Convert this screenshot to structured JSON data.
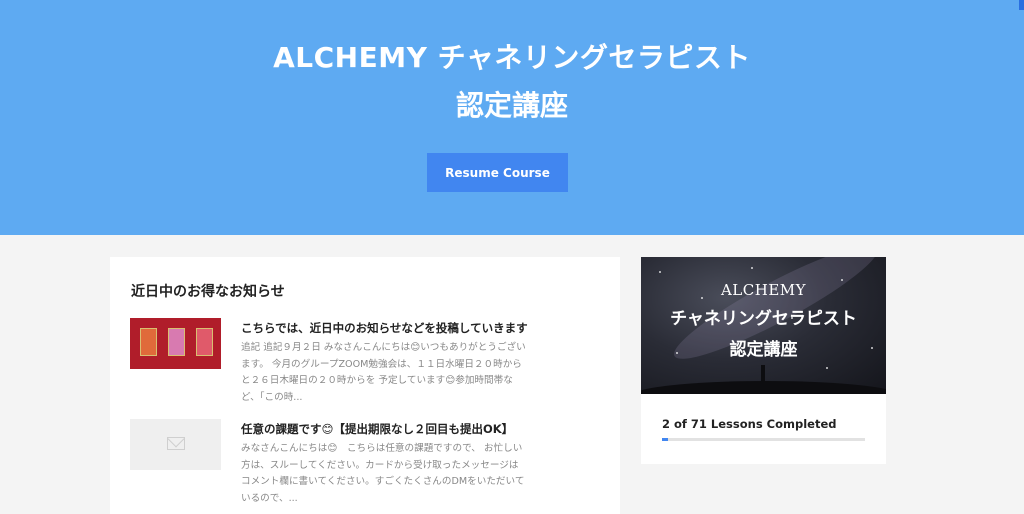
{
  "hero": {
    "title_line1": "ALCHEMY チャネリングセラピスト",
    "title_line2": "認定講座",
    "resume_label": "Resume Course",
    "background_color": "#5eaaf2",
    "button_color": "#4186f0"
  },
  "news": {
    "heading": "近日中のお得なお知らせ",
    "posts": [
      {
        "title": "こちらでは、近日中のお知らせなどを投稿していきます",
        "excerpt": "追記 追記９月２日 みなさんこんにちは😊いつもありがとうございます。 今月のグループZOOM勉強会は、１１日水曜日２０時からと２６日木曜日の２０時からを 予定しています😊参加時間帯など、「この時...",
        "thumbnail": "tarot-cards-image"
      },
      {
        "title": "任意の課題です😊【提出期限なし２回目も提出OK】",
        "excerpt": "みなさんこんにちは😊　こちらは任意の課題ですので、 お忙しい方は、スルーしてください。カードから受け取ったメッセージは コメント欄に書いてください。すごくたくさんのDMをいただいているので、...",
        "thumbnail": "mail-icon"
      }
    ]
  },
  "course": {
    "image_line1": "ALCHEMY",
    "image_line2": "チャネリングセラピスト",
    "image_line3": "認定講座",
    "progress_text": "2 of 71 Lessons Completed",
    "lessons_completed": 2,
    "lessons_total": 71
  }
}
